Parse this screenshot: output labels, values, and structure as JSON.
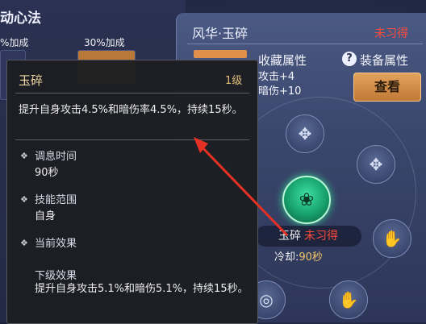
{
  "left_panel": {
    "title": "动心法",
    "pct_left": "%加成",
    "pct_right": "30%加成"
  },
  "detail": {
    "name": "风华·玉碎",
    "status": "未习得",
    "collect_label": "收藏属性",
    "stats": [
      "攻击+4",
      "暗伤+10"
    ],
    "help_icon": "?",
    "equip_label": "装备属性",
    "view_button": "查看"
  },
  "center_skill": {
    "name": "玉碎",
    "status": "未习得",
    "cooldown_label": "冷却:",
    "cooldown_value": "90秒"
  },
  "tooltip": {
    "title": "玉碎",
    "level": "1级",
    "description": "提升自身攻击4.5%和暗伤率4.5%，持续15秒。",
    "sections": [
      {
        "label": "调息时间",
        "value": "90秒"
      },
      {
        "label": "技能范围",
        "value": "自身"
      },
      {
        "label": "当前效果",
        "value": ""
      }
    ],
    "next_label": "下级效果",
    "next_description": "提升自身攻击5.1%和暗伤5.1%，持续15秒。"
  },
  "colors": {
    "accent_orange": "#d98c44",
    "status_red": "#ff4b3a",
    "jade": "#2ecf8e"
  },
  "icons": [
    "help-icon",
    "skill-node-icon",
    "jade-skill-icon",
    "annotation-arrow"
  ]
}
